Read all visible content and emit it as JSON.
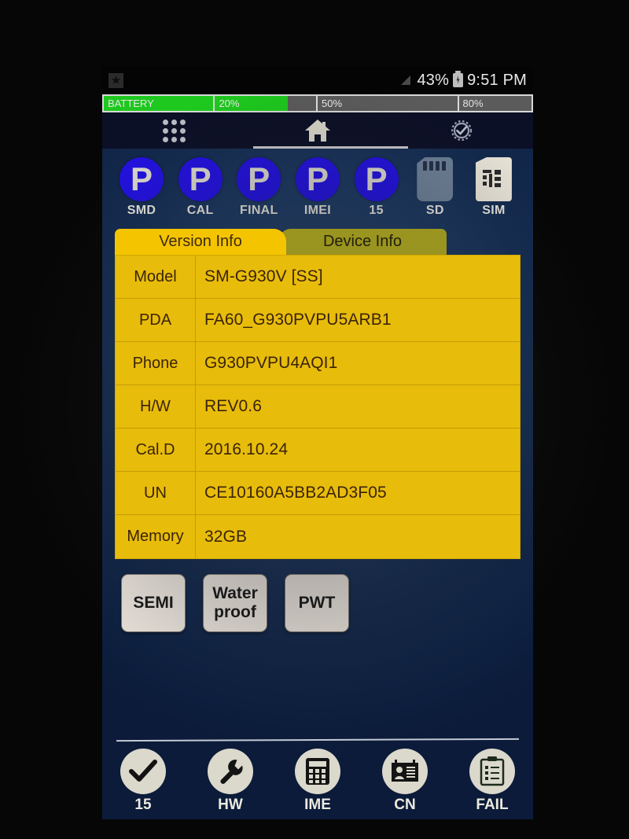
{
  "statusbar": {
    "left_icon": "bookmark-star-icon",
    "signal_icon": "signal-triangle-icon",
    "battery_percent": "43%",
    "battery_icon": "battery-charging-icon",
    "time": "9:51 PM"
  },
  "battery_bar": {
    "fill_percent": 43,
    "segments": [
      {
        "label": "BATTERY"
      },
      {
        "label": "20%"
      },
      {
        "label": "50%"
      },
      {
        "label": "80%"
      }
    ]
  },
  "navbar": {
    "items": [
      {
        "icon": "apps-grid-icon",
        "label": ""
      },
      {
        "icon": "home-icon",
        "label": ""
      },
      {
        "icon": "gear-check-icon",
        "label": ""
      }
    ]
  },
  "badges": [
    {
      "label": "SMD",
      "status": "P",
      "icon": "pass-circle-icon"
    },
    {
      "label": "CAL",
      "status": "P",
      "icon": "pass-circle-icon"
    },
    {
      "label": "FINAL",
      "status": "P",
      "icon": "pass-circle-icon"
    },
    {
      "label": "IMEI",
      "status": "P",
      "icon": "pass-circle-icon"
    },
    {
      "label": "15",
      "status": "P",
      "icon": "pass-circle-icon"
    },
    {
      "label": "SD",
      "status": "",
      "icon": "sd-card-icon"
    },
    {
      "label": "SIM",
      "status": "",
      "icon": "sim-card-icon"
    }
  ],
  "tabs": [
    {
      "label": "Version Info",
      "active": true
    },
    {
      "label": "Device Info",
      "active": false
    }
  ],
  "version_info_table": {
    "rows": [
      {
        "key": "Model",
        "value": "SM-G930V [SS]"
      },
      {
        "key": "PDA",
        "value": "FA60_G930PVPU5ARB1"
      },
      {
        "key": "Phone",
        "value": "G930PVPU4AQI1"
      },
      {
        "key": "H/W",
        "value": "REV0.6"
      },
      {
        "key": "Cal.D",
        "value": "2016.10.24"
      },
      {
        "key": "UN",
        "value": "CE10160A5BB2AD3F05"
      },
      {
        "key": "Memory",
        "value": "32GB"
      }
    ]
  },
  "action_buttons": [
    {
      "label": "SEMI"
    },
    {
      "label": "Water proof"
    },
    {
      "label": "PWT"
    }
  ],
  "bottom_toolbar": [
    {
      "label": "15",
      "icon": "check-mark-icon"
    },
    {
      "label": "HW",
      "icon": "wrench-icon"
    },
    {
      "label": "IME",
      "icon": "calculator-icon"
    },
    {
      "label": "CN",
      "icon": "id-card-icon"
    },
    {
      "label": "FAIL",
      "icon": "clipboard-list-icon"
    }
  ],
  "colors": {
    "pass_badge": "#2211e0",
    "tab_active": "#f5c400",
    "tab_inactive": "#9a9420",
    "table_bg": "#e8bc0b",
    "battery_fill": "#1ec81e",
    "screen_bg": "#1c3a64"
  }
}
